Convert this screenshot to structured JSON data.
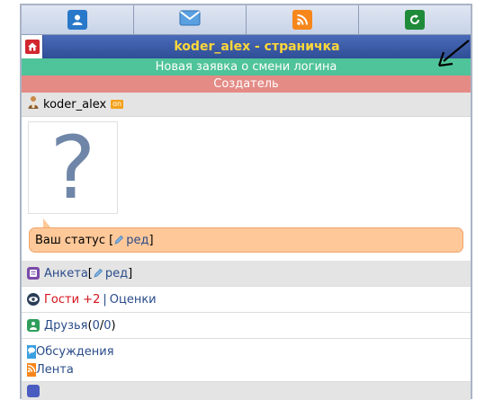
{
  "title": "koder_alex - страничка",
  "notices": {
    "green": "Новая заявка о смени логина",
    "red": "Создатель"
  },
  "user": {
    "name": "koder_alex",
    "online_badge": "on"
  },
  "avatar": {
    "placeholder": "?"
  },
  "status": {
    "label": "Ваш статус [",
    "edit": "ред",
    "close": "]"
  },
  "menu": {
    "anketa": {
      "label": "Анкета",
      "open": " [",
      "edit": "ред",
      "close": "]"
    },
    "guests": {
      "label": "Гости +2",
      "sep": "|",
      "ratings": "Оценки"
    },
    "friends": {
      "label": "Друзья",
      "open": " (",
      "online": "0",
      "slash": "/",
      "total": "0",
      "close": ")"
    },
    "discussions": "Обсуждения",
    "feed": "Лента"
  },
  "colors": {
    "title_text": "#ffd83a",
    "green_bar": "#4fc39a",
    "red_bar": "#e48b86",
    "bubble": "#ffc899",
    "link": "#2a4c8a",
    "guests": "#d4121b"
  },
  "icons": {
    "toolbar": [
      "user-icon",
      "mail-icon",
      "rss-icon",
      "refresh-icon"
    ],
    "home": "home-icon"
  }
}
